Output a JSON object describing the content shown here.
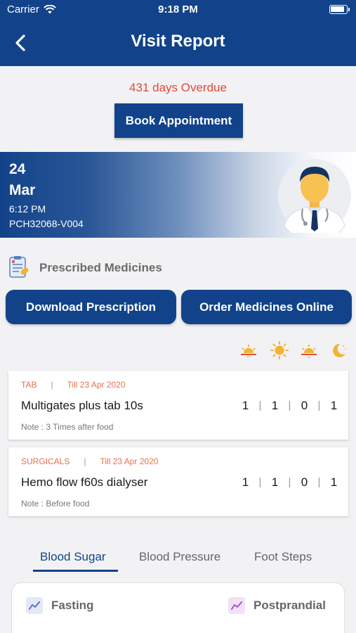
{
  "status_bar": {
    "carrier": "Carrier",
    "time": "9:18 PM"
  },
  "header": {
    "title": "Visit Report",
    "back_icon": "chevron-left-icon"
  },
  "overdue_text": "431 days Overdue",
  "book_button": "Book Appointment",
  "visit": {
    "day": "24",
    "month": "Mar",
    "time": "6:12 PM",
    "id": "PCH32068-V004"
  },
  "prescribed": {
    "label": "Prescribed Medicines",
    "download_button": "Download Prescription",
    "order_button": "Order Medicines Online"
  },
  "time_icons": [
    "sunrise-icon",
    "sun-icon",
    "sunset-icon",
    "moon-icon"
  ],
  "medicines": [
    {
      "type": "TAB",
      "till": "Till 23 Apr 2020",
      "name": "Multigates plus tab 10s",
      "doses": [
        "1",
        "1",
        "0",
        "1"
      ],
      "note": "Note : 3 Times after food"
    },
    {
      "type": "SURGICALS",
      "till": "Till 23 Apr 2020",
      "name": "Hemo flow f60s dialyser",
      "doses": [
        "1",
        "1",
        "0",
        "1"
      ],
      "note": "Note : Before food"
    }
  ],
  "dose_separator": "|",
  "meta_separator": "|",
  "tabs": [
    {
      "label": "Blood Sugar",
      "active": true
    },
    {
      "label": "Blood Pressure",
      "active": false
    },
    {
      "label": "Foot Steps",
      "active": false
    }
  ],
  "chart_legend": {
    "fasting": "Fasting",
    "postprandial": "Postprandial"
  },
  "colors": {
    "primary": "#12438a",
    "overdue": "#e2483a",
    "meta_orange": "#e8704a",
    "fasting_icon": "#5b73c9",
    "postprandial_icon": "#a457c2"
  }
}
